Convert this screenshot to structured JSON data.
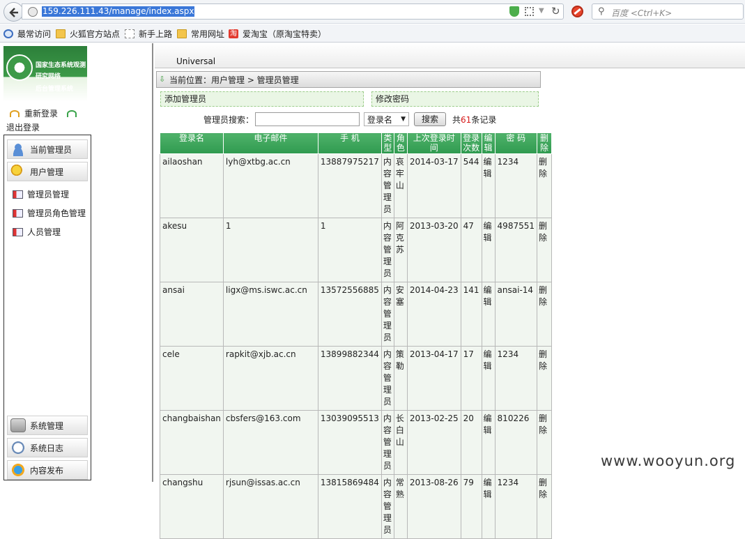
{
  "browser": {
    "url": "159.226.111.43/manage/index.aspx",
    "search_placeholder": "百度 <Ctrl+K>",
    "bookmarks": [
      "最常访问",
      "火狐官方站点",
      "新手上路",
      "常用网址",
      "爱淘宝（原淘宝特卖）"
    ]
  },
  "sidebar": {
    "logo_lines": [
      "国家生态系统观测",
      "研究网络",
      "后台管理系统"
    ],
    "relogin": "重新登录",
    "logout": "退出登录",
    "menu_current_admin": "当前管理员",
    "menu_user_mgmt": "用户管理",
    "sub_items": [
      "管理员管理",
      "管理员角色管理",
      "人员管理"
    ],
    "menu_system": "系统管理",
    "menu_syslog": "系统日志",
    "menu_publish": "内容发布"
  },
  "main": {
    "tab": "Universal",
    "breadcrumb": "当前位置：用户管理 > 管理员管理",
    "add_admin": "添加管理员",
    "change_password": "修改密码",
    "search_label": "管理员搜索：",
    "search_field": "登录名",
    "search_button": "搜索",
    "count_prefix": "共",
    "count_num": "61",
    "count_suffix": "条记录"
  },
  "table": {
    "headers": [
      "登录名",
      "电子邮件",
      "手 机",
      "类型",
      "角色",
      "上次登录时间",
      "登录次数",
      "编辑",
      "密 码",
      "删除"
    ],
    "rows": [
      {
        "login": "ailaoshan",
        "email": "lyh@xtbg.ac.cn",
        "phone": "13887975217",
        "type": "内容管理员",
        "role": "哀牢山",
        "last": "2014-03-17",
        "count": "544",
        "edit": "编辑",
        "pwd": "1234",
        "del": "删除"
      },
      {
        "login": "akesu",
        "email": "1",
        "phone": "1",
        "type": "内容管理员",
        "role": "阿克苏",
        "last": "2013-03-20",
        "count": "47",
        "edit": "编辑",
        "pwd": "4987551",
        "del": "删除"
      },
      {
        "login": "ansai",
        "email": "ligx@ms.iswc.ac.cn",
        "phone": "13572556885",
        "type": "内容管理员",
        "role": "安塞",
        "last": "2014-04-23",
        "count": "141",
        "edit": "编辑",
        "pwd": "ansai-14",
        "del": "删除"
      },
      {
        "login": "cele",
        "email": "rapkit@xjb.ac.cn",
        "phone": "13899882344",
        "type": "内容管理员",
        "role": "策勒",
        "last": "2013-04-17",
        "count": "17",
        "edit": "编辑",
        "pwd": "1234",
        "del": "删除"
      },
      {
        "login": "changbaishan",
        "email": "cbsfers@163.com",
        "phone": "13039095513",
        "type": "内容管理员",
        "role": "长白山",
        "last": "2013-02-25",
        "count": "20",
        "edit": "编辑",
        "pwd": "810226",
        "del": "删除"
      },
      {
        "login": "changshu",
        "email": "rjsun@issas.ac.cn",
        "phone": "13815869484",
        "type": "内容管理员",
        "role": "常熟",
        "last": "2013-08-26",
        "count": "79",
        "edit": "编辑",
        "pwd": "1234",
        "del": "删除"
      }
    ]
  },
  "watermark": "www.wooyun.org"
}
